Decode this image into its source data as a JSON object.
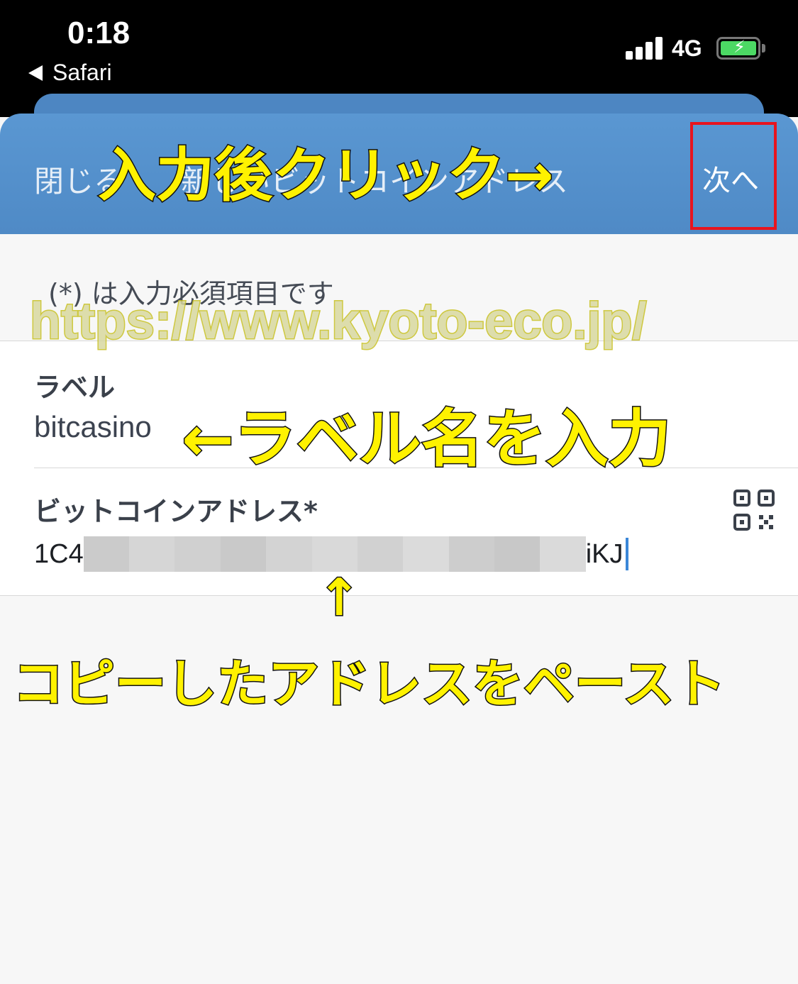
{
  "status_bar": {
    "time": "0:18",
    "back_app": "Safari",
    "network": "4G",
    "battery_icon": "battery-charging-icon",
    "signal_icon": "cellular-signal-icon"
  },
  "nav": {
    "close_label": "閉じる",
    "title": "新しいビットコインアドレス",
    "next_label": "次へ"
  },
  "form": {
    "required_note": "(*) は入力必須項目です",
    "label_heading": "ラベル",
    "label_value": "bitcasino",
    "address_heading": "ビットコインアドレス*",
    "address_prefix": "1C4",
    "address_suffix": "iKJ",
    "qr_icon": "qr-code-icon"
  },
  "annotations": {
    "click_after_input": "入力後クリック→",
    "watermark_url": "https://www.kyoto-eco.jp/",
    "enter_label": "←ラベル名を入力",
    "arrow_up": "↑",
    "paste_address": "コピーしたアドレスをペースト"
  },
  "colors": {
    "nav_bar": "#5291cd",
    "highlight_box": "#e8141e",
    "annotation_text": "#fff200",
    "caret": "#3b87d8"
  }
}
